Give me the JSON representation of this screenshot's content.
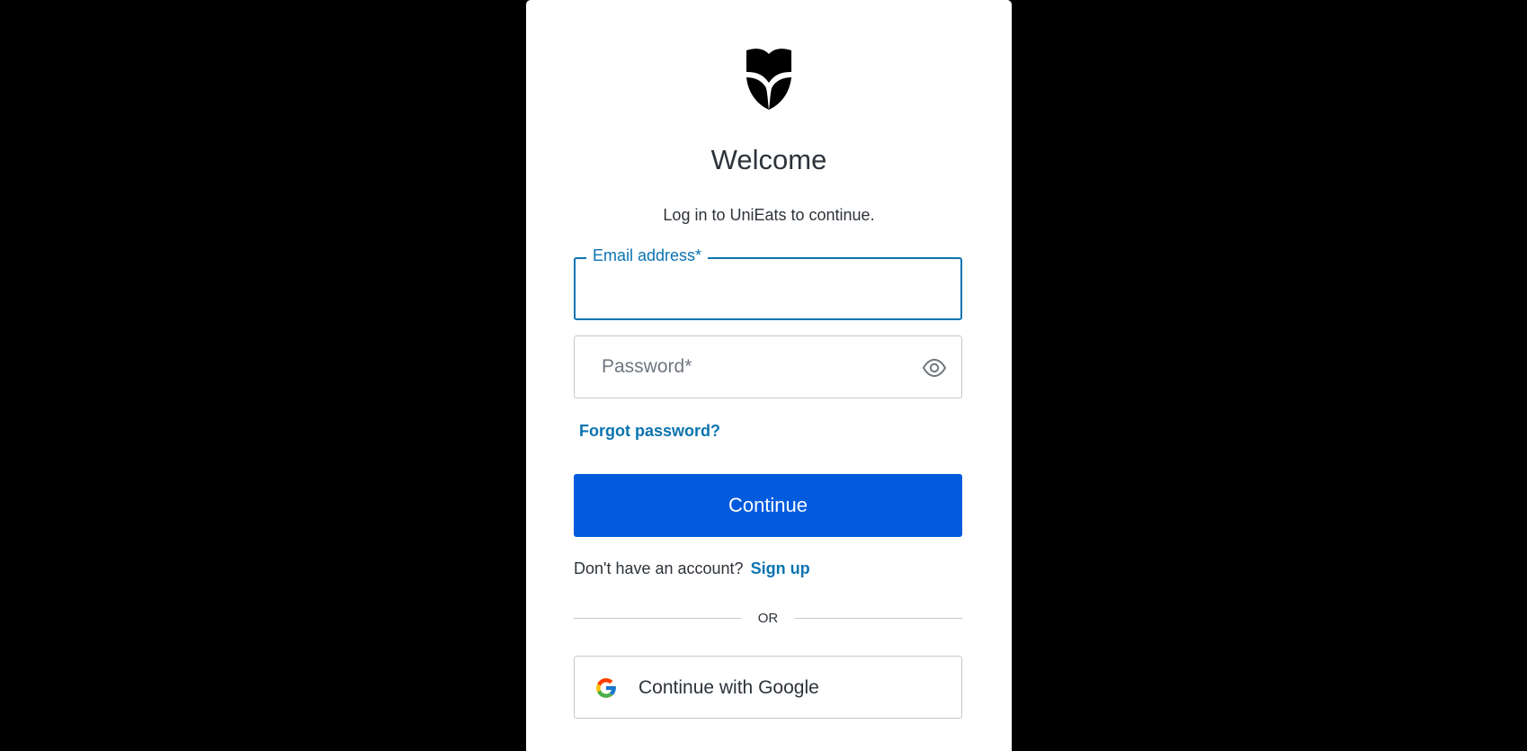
{
  "auth": {
    "title": "Welcome",
    "subtitle": "Log in to UniEats to continue.",
    "email_label": "Email address*",
    "email_value": "",
    "password_placeholder": "Password*",
    "password_value": "",
    "forgot_link": "Forgot password?",
    "continue_label": "Continue",
    "signup_prompt": "Don't have an account?",
    "signup_link": "Sign up",
    "divider_text": "OR",
    "google_label": "Continue with Google"
  },
  "icons": {
    "logo": "shield-star-icon",
    "password_toggle": "eye-icon",
    "google": "google-icon"
  },
  "colors": {
    "background": "#000000",
    "card": "#ffffff",
    "primary_button": "#025bdd",
    "link": "#0b74b0",
    "focus_border": "#0b74b0",
    "text": "#2d333a",
    "border": "#c2c8d0"
  }
}
